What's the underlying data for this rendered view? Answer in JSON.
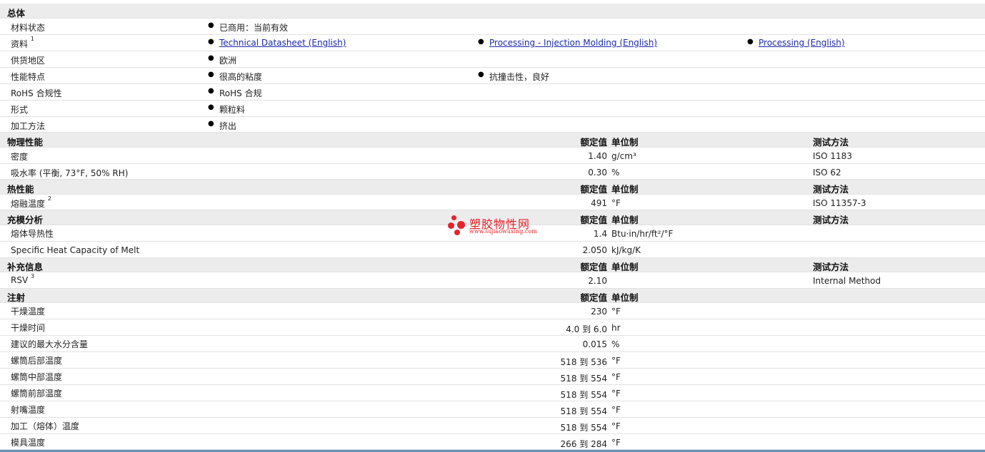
{
  "sections": {
    "general": "总体",
    "physical": "物理性能",
    "thermal": "热性能",
    "filling": "充模分析",
    "supplement": "补充信息",
    "injection": "注射"
  },
  "headers": {
    "nominal": "额定值",
    "unit": "单位制",
    "test": "测试方法"
  },
  "general": {
    "status_label": "材料状态",
    "status_value": "已商用：当前有效",
    "docs_label": "资料",
    "docs_sup": "1",
    "doc1": "Technical Datasheet (English)",
    "doc2": "Processing - Injection Molding (English)",
    "doc3": "Processing (English)",
    "region_label": "供货地区",
    "region_value": "欧洲",
    "features_label": "性能特点",
    "feature1": "很高的粘度",
    "feature2": "抗撞击性，良好",
    "rohs_label": "RoHS 合规性",
    "rohs_value": "RoHS 合规",
    "form_label": "形式",
    "form_value": "颗粒料",
    "method_label": "加工方法",
    "method_value": "挤出"
  },
  "physical": [
    {
      "label": "密度",
      "value": "1.40",
      "unit": "g/cm³",
      "test": "ISO 1183"
    },
    {
      "label": "吸水率 (平衡, 73°F, 50% RH)",
      "value": "0.30",
      "unit": "%",
      "test": "ISO 62"
    }
  ],
  "thermal": [
    {
      "label": "熔融温度",
      "sup": "2",
      "value": "491",
      "unit": "°F",
      "test": "ISO 11357-3"
    }
  ],
  "filling": [
    {
      "label": "熔体导热性",
      "value": "1.4",
      "unit": "Btu·in/hr/ft²/°F"
    },
    {
      "label": "Specific Heat Capacity of Melt",
      "value": "2.050",
      "unit": "kJ/kg/K"
    }
  ],
  "supplement": [
    {
      "label": "RSV",
      "sup": "3",
      "value": "2.10",
      "test": "Internal Method"
    }
  ],
  "injection": [
    {
      "label": "干燥温度",
      "value": "230",
      "unit": "°F"
    },
    {
      "label": "干燥时间",
      "value": "4.0 到  6.0",
      "unit": "hr"
    },
    {
      "label": "建议的最大水分含量",
      "value": "0.015",
      "unit": "%"
    },
    {
      "label": "螺筒后部温度",
      "value": "518 到  536",
      "unit": "°F"
    },
    {
      "label": "螺筒中部温度",
      "value": "518 到  554",
      "unit": "°F"
    },
    {
      "label": "螺筒前部温度",
      "value": "518 到  554",
      "unit": "°F"
    },
    {
      "label": "射嘴温度",
      "value": "518 到  554",
      "unit": "°F"
    },
    {
      "label": "加工（熔体）温度",
      "value": "518 到  554",
      "unit": "°F"
    },
    {
      "label": "模具温度",
      "value": "266 到  284",
      "unit": "°F"
    }
  ],
  "watermark": {
    "title": "塑胶物性网",
    "url": "www.sujiaowuxing.com"
  },
  "colors": {
    "section_bg": "#ececec",
    "link": "#1a2aa8",
    "watermark": "#e8222a"
  }
}
